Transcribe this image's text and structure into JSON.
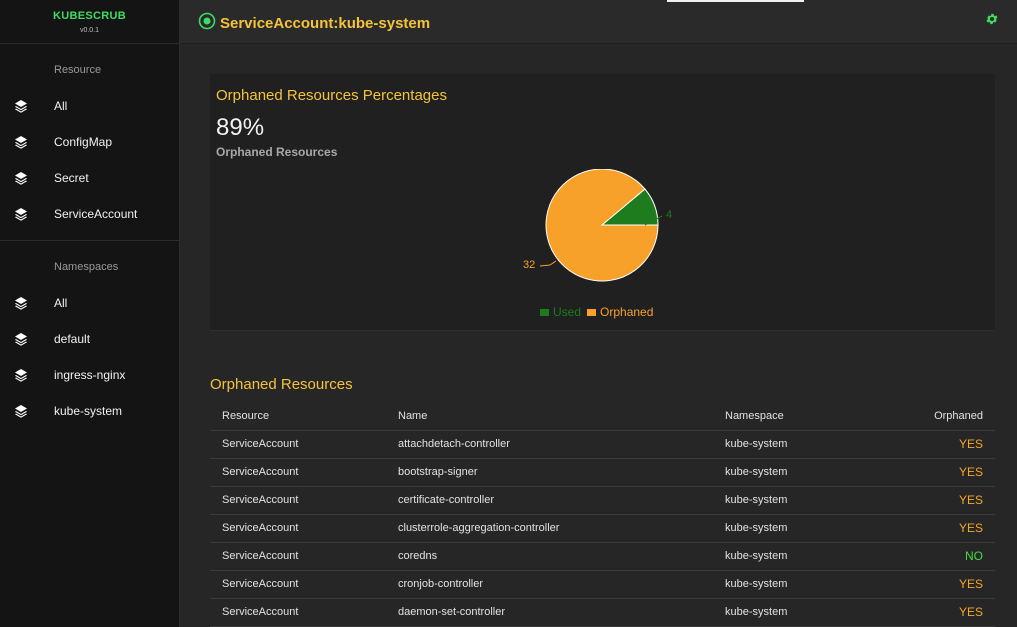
{
  "brand": {
    "name": "KUBESCRUB",
    "version": "v0.0.1"
  },
  "sidebar": {
    "resource_heading": "Resource",
    "resources": [
      {
        "label": "All",
        "icon": "layers-icon"
      },
      {
        "label": "ConfigMap",
        "icon": "layers-icon"
      },
      {
        "label": "Secret",
        "icon": "layers-icon"
      },
      {
        "label": "ServiceAccount",
        "icon": "layers-icon"
      }
    ],
    "namespace_heading": "Namespaces",
    "namespaces": [
      {
        "label": "All",
        "icon": "layers-icon"
      },
      {
        "label": "default",
        "icon": "layers-icon"
      },
      {
        "label": "ingress-nginx",
        "icon": "layers-icon"
      },
      {
        "label": "kube-system",
        "icon": "layers-icon"
      }
    ]
  },
  "header": {
    "title": "ServiceAccount:kube-system",
    "settings_icon": "gear-icon",
    "title_icon": "target-icon"
  },
  "summary": {
    "title": "Orphaned Resources Percentages",
    "percentage": "89%",
    "subtitle": "Orphaned Resources",
    "used_label": "4",
    "orphaned_label": "32"
  },
  "chart_data": {
    "type": "pie",
    "categories": [
      "Used",
      "Orphaned"
    ],
    "values": [
      4,
      32
    ],
    "colors": [
      "#1e7b1e",
      "#f8a12a"
    ],
    "legend": "bottom"
  },
  "table": {
    "title": "Orphaned Resources",
    "columns": [
      "Resource",
      "Name",
      "Namespace",
      "Orphaned"
    ],
    "rows": [
      [
        "ServiceAccount",
        "attachdetach-controller",
        "kube-system",
        "YES"
      ],
      [
        "ServiceAccount",
        "bootstrap-signer",
        "kube-system",
        "YES"
      ],
      [
        "ServiceAccount",
        "certificate-controller",
        "kube-system",
        "YES"
      ],
      [
        "ServiceAccount",
        "clusterrole-aggregation-controller",
        "kube-system",
        "YES"
      ],
      [
        "ServiceAccount",
        "coredns",
        "kube-system",
        "NO"
      ],
      [
        "ServiceAccount",
        "cronjob-controller",
        "kube-system",
        "YES"
      ],
      [
        "ServiceAccount",
        "daemon-set-controller",
        "kube-system",
        "YES"
      ]
    ]
  },
  "colors": {
    "accent": "#f5c33a",
    "brand": "#3ddc63",
    "yes": "#f5a623",
    "no": "#44dd44"
  }
}
